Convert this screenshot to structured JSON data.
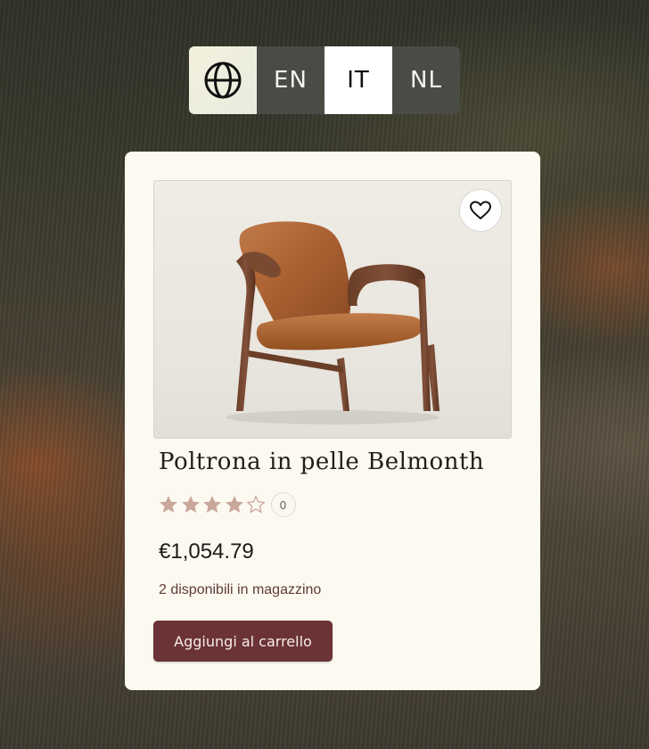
{
  "language_switcher": {
    "icon": "globe-icon",
    "languages": [
      {
        "code": "EN",
        "active": false
      },
      {
        "code": "IT",
        "active": true
      },
      {
        "code": "NL",
        "active": false
      }
    ]
  },
  "product": {
    "title": "Poltrona in pelle Belmonth",
    "rating": 4,
    "rating_max": 5,
    "review_count": "0",
    "price": "€1,054.79",
    "stock": "2 disponibili in magazzino",
    "add_to_cart_label": "Aggiungi al carrello",
    "wishlist_icon": "heart-icon",
    "image": "leather-armchair-image"
  },
  "colors": {
    "card_background": "#fcf9f1",
    "cart_button": "#6b3336",
    "star_filled": "#c9a79a",
    "active_language_bg": "#ffffff",
    "inactive_language_bg": "#4b4d48"
  }
}
